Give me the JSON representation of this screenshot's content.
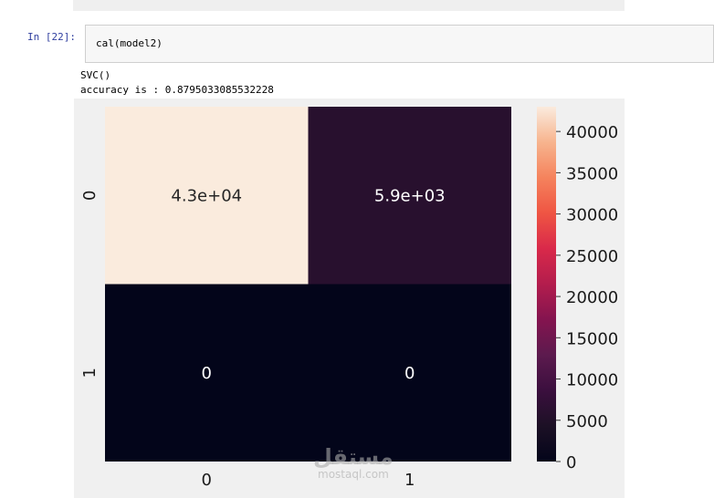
{
  "notebook": {
    "prompt": "In [22]:",
    "code": "cal(model2)",
    "output_lines": [
      "SVC()",
      "accuracy is : 0.8795033085532228"
    ]
  },
  "watermark": {
    "arabic": "مستقل",
    "latin": "mostaql.com"
  },
  "chart_data": {
    "type": "heatmap",
    "title": "",
    "xlabel": "",
    "ylabel": "",
    "x_ticks": [
      "0",
      "1"
    ],
    "y_ticks": [
      "0",
      "1"
    ],
    "values": [
      [
        43000,
        5900
      ],
      [
        0,
        0
      ]
    ],
    "annotations": [
      [
        "4.3e+04",
        "5.9e+03"
      ],
      [
        "0",
        "0"
      ]
    ],
    "colorbar": {
      "ticks": [
        "0",
        "5000",
        "10000",
        "15000",
        "20000",
        "25000",
        "30000",
        "35000",
        "40000"
      ],
      "range": [
        0,
        43000
      ],
      "colormap": "rocket"
    }
  }
}
